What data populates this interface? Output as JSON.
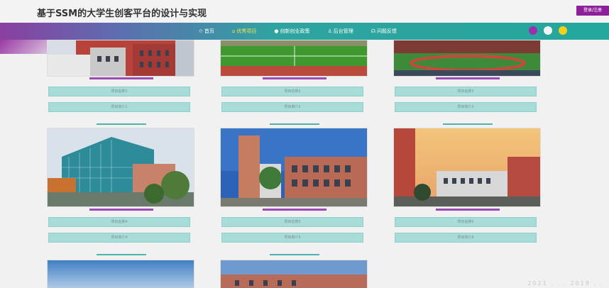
{
  "header": {
    "title": "基于SSM的大学生创客平台的设计与实现",
    "login_label": "登录/注册"
  },
  "nav": {
    "items": [
      {
        "label": "首页",
        "icon": "star-icon",
        "active": false
      },
      {
        "label": "优秀项目",
        "icon": "home-icon",
        "active": true
      },
      {
        "label": "创新创业政策",
        "icon": "circle-icon",
        "active": false
      },
      {
        "label": "后台管理",
        "icon": "user-icon",
        "active": false
      },
      {
        "label": "问题反馈",
        "icon": "feedback-icon",
        "active": false
      }
    ]
  },
  "theme_dots": [
    "#9b2fae",
    "#f4f4f4",
    "#f1d11a"
  ],
  "projects": [
    {
      "line1": "项目名称1",
      "line2": "项目简介1"
    },
    {
      "line1": "项目名称2",
      "line2": "项目简介2"
    },
    {
      "line1": "项目名称3",
      "line2": "项目简介3"
    },
    {
      "line1": "项目名称4",
      "line2": "项目简介4"
    },
    {
      "line1": "项目名称5",
      "line2": "项目简介5"
    },
    {
      "line1": "项目名称6",
      "line2": "项目简介6"
    },
    {
      "line1": "",
      "line2": ""
    },
    {
      "line1": "",
      "line2": ""
    }
  ],
  "watermark": "2021 . . . 2019 . ."
}
